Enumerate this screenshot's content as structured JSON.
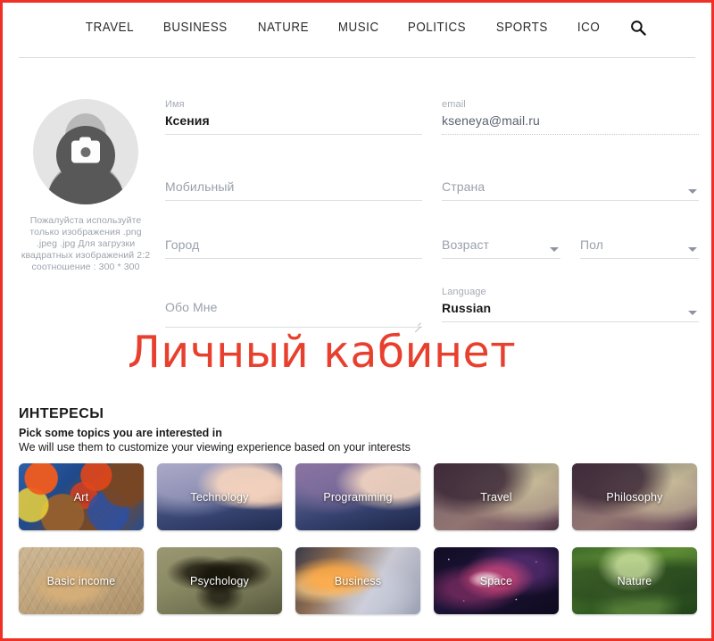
{
  "nav": {
    "items": [
      {
        "label": "TRAVEL"
      },
      {
        "label": "BUSINESS"
      },
      {
        "label": "NATURE"
      },
      {
        "label": "MUSIC"
      },
      {
        "label": "POLITICS"
      },
      {
        "label": "SPORTS"
      },
      {
        "label": "ICO"
      }
    ],
    "search_icon": "search-icon"
  },
  "avatar": {
    "icon": "camera-icon",
    "hint": "Пожалуйста используйте только изображения .png .jpeg .jpg Для загрузки квадратных изображений 2:2 соотношение : 300 * 300"
  },
  "form": {
    "name": {
      "label": "Имя",
      "value": "Ксения",
      "placeholder": ""
    },
    "email": {
      "label": "email",
      "value": "kseneya@mail.ru",
      "placeholder": ""
    },
    "mobile": {
      "label": "",
      "value": "",
      "placeholder": "Мобильный"
    },
    "country": {
      "label": "",
      "value": "",
      "placeholder": "Страна",
      "caret": "chevron-down-icon"
    },
    "city": {
      "label": "",
      "value": "",
      "placeholder": "Город"
    },
    "age": {
      "label": "",
      "value": "",
      "placeholder": "Возраст",
      "caret": "chevron-down-icon"
    },
    "gender": {
      "label": "",
      "value": "",
      "placeholder": "Пол",
      "caret": "chevron-down-icon"
    },
    "about": {
      "label": "",
      "value": "",
      "placeholder": "Обо Мне"
    },
    "language": {
      "label": "Language",
      "value": "Russian",
      "placeholder": "",
      "caret": "chevron-down-icon"
    }
  },
  "watermark": {
    "text": "Личный кабинет",
    "color": "#e8402e"
  },
  "frame": {
    "border_color": "#ee3124"
  },
  "interests": {
    "title": "ИНТЕРЕСЫ",
    "subtitle_bold": "Pick some topics you are interested in",
    "subtitle": "We will use them to customize your viewing experience based on your interests",
    "cards": [
      {
        "label": "Art",
        "style": "bg-art"
      },
      {
        "label": "Technology",
        "style": "bg-tech"
      },
      {
        "label": "Programming",
        "style": "bg-prog"
      },
      {
        "label": "Travel",
        "style": "bg-ship"
      },
      {
        "label": "Philosophy",
        "style": "bg-ship"
      },
      {
        "label": "Basic income",
        "style": "bg-coin"
      },
      {
        "label": "Psychology",
        "style": "bg-psych"
      },
      {
        "label": "Business",
        "style": "bg-biz"
      },
      {
        "label": "Space",
        "style": "bg-space"
      },
      {
        "label": "Nature",
        "style": "bg-nature"
      }
    ]
  }
}
